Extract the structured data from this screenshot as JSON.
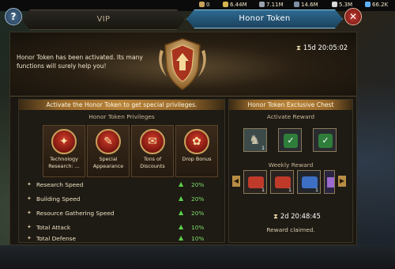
{
  "resources": [
    {
      "icon": "wood-icon",
      "value": "0",
      "color": "#c9a25c"
    },
    {
      "icon": "food-icon",
      "value": "6.44M",
      "color": "#d6b650"
    },
    {
      "icon": "stone-icon",
      "value": "7.11M",
      "color": "#9aa3ad"
    },
    {
      "icon": "iron-icon",
      "value": "14.6M",
      "color": "#7f8fa6"
    },
    {
      "icon": "silver-icon",
      "value": "5.3M",
      "color": "#d8d8d8"
    },
    {
      "icon": "gem-icon",
      "value": "66.2K",
      "color": "#5fb0ff"
    }
  ],
  "tabs": {
    "vip": "VIP",
    "honor": "Honor Token"
  },
  "banner": {
    "message": "Honor Token has been activated. Its many functions will surely help you!",
    "timer": "15d 20:05:02"
  },
  "privileges": {
    "header": "Activate the Honor Token to get special privileges.",
    "subheader": "Honor Token Privileges",
    "cards": [
      {
        "label": "Technology Research: ...",
        "icon": "book-icon",
        "glyph": "📖"
      },
      {
        "label": "Special Appearance",
        "icon": "brush-icon",
        "glyph": "✎"
      },
      {
        "label": "Tons of Discounts",
        "icon": "scroll-icon",
        "glyph": "✉"
      },
      {
        "label": "Drop Bonus",
        "icon": "sack-icon",
        "glyph": "✿"
      }
    ],
    "stats": [
      {
        "name": "Research Speed",
        "value": "20%"
      },
      {
        "name": "Building Speed",
        "value": "20%"
      },
      {
        "name": "Resource Gathering Speed",
        "value": "20%"
      },
      {
        "name": "Total Attack",
        "value": "10%"
      },
      {
        "name": "Total Defense",
        "value": "10%"
      }
    ]
  },
  "chest": {
    "header": "Honor Token Exclusive Chest",
    "activate_label": "Activate Reward",
    "activate_count": "1",
    "weekly_label": "Weekly Reward",
    "weekly_counts": [
      "1",
      "1",
      "1"
    ],
    "timer": "2d 20:48:45",
    "status": "Reward claimed."
  },
  "colors": {
    "accent": "#b8833a",
    "tab_active": "#2e6c92",
    "positive": "#7fe06a"
  }
}
